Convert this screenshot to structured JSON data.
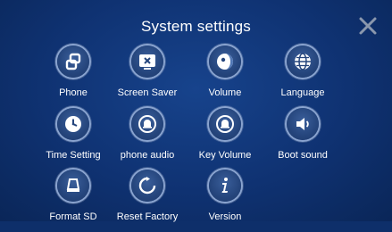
{
  "header": {
    "title": "System settings"
  },
  "tiles": [
    {
      "label": "Phone",
      "icon": "phone-link-icon"
    },
    {
      "label": "Screen Saver",
      "icon": "screen-saver-icon"
    },
    {
      "label": "Volume",
      "icon": "volume-icon"
    },
    {
      "label": "Language",
      "icon": "globe-icon"
    },
    {
      "label": "Time Setting",
      "icon": "clock-icon"
    },
    {
      "label": "phone audio",
      "icon": "bell-icon"
    },
    {
      "label": "Key Volume",
      "icon": "bell-icon"
    },
    {
      "label": "Boot sound",
      "icon": "speaker-icon"
    },
    {
      "label": "Format SD",
      "icon": "format-icon"
    },
    {
      "label": "Reset Factory",
      "icon": "reset-icon"
    },
    {
      "label": "Version",
      "icon": "info-icon"
    }
  ],
  "colors": {
    "background": "#0f3272",
    "icon_ring": "#89a3cf",
    "icon_fill": "#25457c",
    "close_icon": "#8a97ad",
    "text": "#ffffff"
  }
}
